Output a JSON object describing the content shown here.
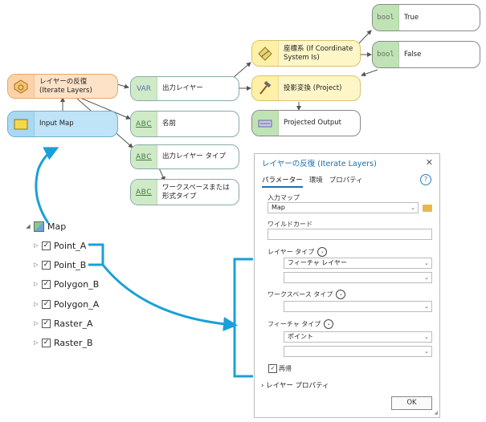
{
  "model": {
    "iterate_node": "レイヤーの反復 (Iterate Layers)",
    "input_map_node": "Input Map",
    "output_layer_var": "出力レイヤー",
    "var_tag": "VAR",
    "name_var": "名前",
    "output_layer_type_var": "出力レイヤー タイプ",
    "workspace_var": "ワークスペースまたは形式タイプ",
    "abc_tag": "ABC",
    "coord_tool": "座標系 (If Coordinate System Is)",
    "project_tool": "投影変換 (Project)",
    "projected_output": "Projected Output",
    "bool_tag": "bool",
    "true_node": "True",
    "false_node": "False"
  },
  "tree": {
    "root": "Map",
    "layers": [
      "Point_A",
      "Point_B",
      "Polygon_B",
      "Polygon_A",
      "Raster_A",
      "Raster_B"
    ]
  },
  "dialog": {
    "title": "レイヤーの反復 (Iterate Layers)",
    "close": "✕",
    "tabs": [
      "パラメーター",
      "環境",
      "プロパティ"
    ],
    "help": "?",
    "input_map_label": "入力マップ",
    "input_map_value": "Map",
    "wildcard_label": "ワイルドカード",
    "wildcard_value": "",
    "layer_type_label": "レイヤー タイプ",
    "layer_type_value": "フィーチャ レイヤー",
    "workspace_type_label": "ワークスペース タイプ",
    "feature_type_label": "フィーチャ タイプ",
    "feature_type_value": "ポイント",
    "recursive_label": "再帰",
    "layer_properties_label": "レイヤー プロパティ",
    "ok": "OK"
  },
  "colors": {
    "accent": "#1a6eaf",
    "callout": "#1aa0d8"
  }
}
